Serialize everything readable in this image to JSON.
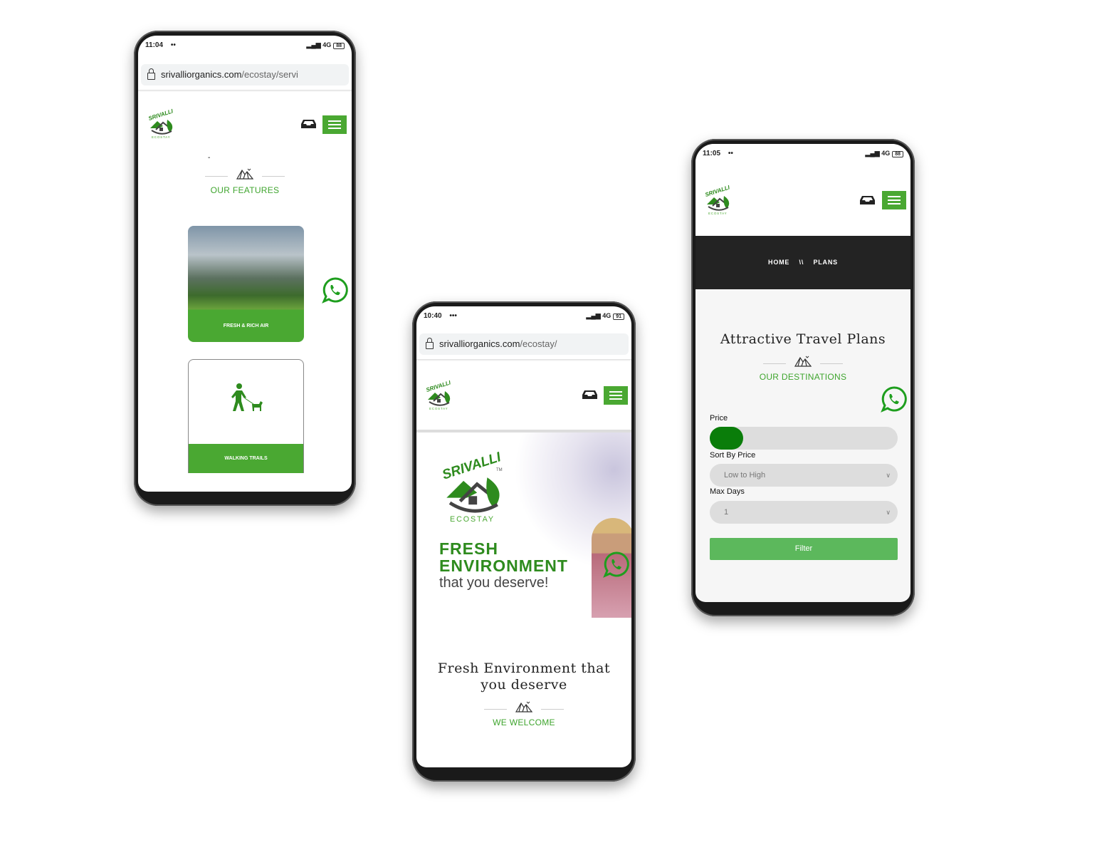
{
  "brand": {
    "logo_text": "SRIVALLI",
    "logo_sub": "ECOSTAY",
    "green": "#4aa832",
    "dark_green": "#2e8b1e"
  },
  "phone_left": {
    "status": {
      "time": "11:04",
      "dots": "••",
      "network": "4G",
      "battery": "88"
    },
    "url": {
      "domain": "srivalliorganics.com",
      "path": "/ecostay/servi"
    },
    "stray_text": "-",
    "section_kicker": "OUR FEATURES",
    "cards": [
      {
        "label": "FRESH & RICH AIR",
        "image": "mountain-landscape"
      },
      {
        "label": "WALKING TRAILS",
        "icon": "person-walking-dog-icon"
      }
    ]
  },
  "phone_middle": {
    "status": {
      "time": "10:40",
      "dots": "•••",
      "network": "4G",
      "battery": "91"
    },
    "url": {
      "domain": "srivalliorganics.com",
      "path": "/ecostay/"
    },
    "hero": {
      "line1": "FRESH",
      "line2": "ENVIRONMENT",
      "line3": "that you deserve!",
      "logo_sub": "ECOSTAY",
      "tm": "TM"
    },
    "title": "Fresh Environment that you deserve",
    "section_kicker": "WE WELCOME"
  },
  "phone_right": {
    "status": {
      "time": "11:05",
      "dots": "••",
      "network": "4G",
      "battery": "88"
    },
    "breadcrumb": {
      "home": "HOME",
      "separator": "\\\\",
      "current": "PLANS"
    },
    "title": "Attractive Travel Plans",
    "section_kicker": "OUR DESTINATIONS",
    "filters": {
      "price_label": "Price",
      "price_value_fraction": 0,
      "sort_label": "Sort By Price",
      "sort_value": "Low to High",
      "days_label": "Max Days",
      "days_value": "1",
      "filter_button": "Filter"
    }
  }
}
